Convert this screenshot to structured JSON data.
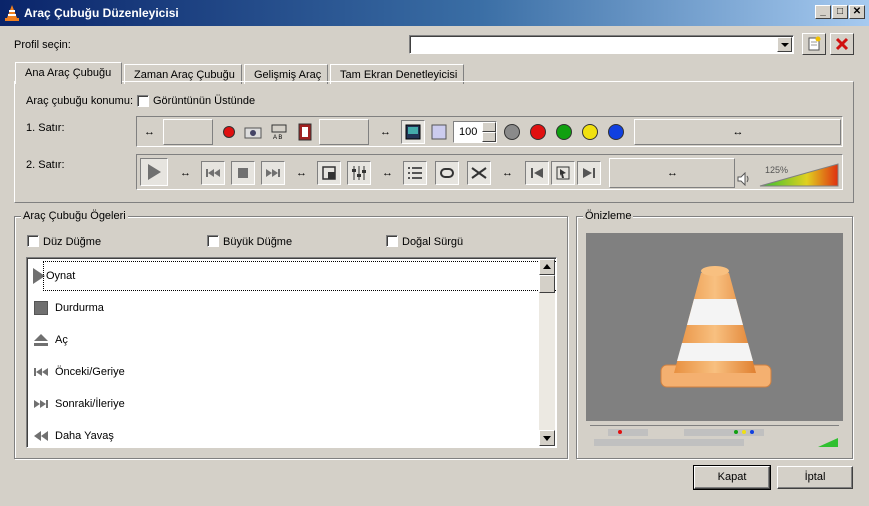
{
  "window": {
    "title": "Araç Çubuğu Düzenleyicisi"
  },
  "profile": {
    "label": "Profil seçin:",
    "value": ""
  },
  "tabs": [
    "Ana Araç Çubuğu",
    "Zaman Araç Çubuğu",
    "Gelişmiş Araç",
    "Tam Ekran Denetleyicisi"
  ],
  "main_tab": {
    "position_label": "Araç çubuğu konumu:",
    "above_video_label": "Görüntünün Üstünde",
    "row1_label": "1. Satır:",
    "row2_label": "2. Satır:",
    "zoom_value": "100",
    "volume_percent": "125%"
  },
  "items_group": {
    "title": "Araç Çubuğu Ögeleri",
    "flat_button": "Düz Düğme",
    "big_button": "Büyük Düğme",
    "native_slider": "Doğal Sürgü",
    "items": [
      {
        "label": "Oynat",
        "icon": "play-icon"
      },
      {
        "label": "Durdurma",
        "icon": "stop-icon"
      },
      {
        "label": "Aç",
        "icon": "eject-icon"
      },
      {
        "label": "Önceki/Geriye",
        "icon": "previous-icon"
      },
      {
        "label": "Sonraki/İleriye",
        "icon": "next-icon"
      },
      {
        "label": "Daha Yavaş",
        "icon": "slower-icon"
      }
    ]
  },
  "preview_group": {
    "title": "Önizleme"
  },
  "buttons": {
    "close": "Kapat",
    "cancel": "İptal"
  },
  "colors": {
    "titlebar_start": "#0a246a",
    "titlebar_end": "#a6caf0",
    "cone_orange": "#f0a050",
    "dialog_bg": "#d4d0c8"
  }
}
